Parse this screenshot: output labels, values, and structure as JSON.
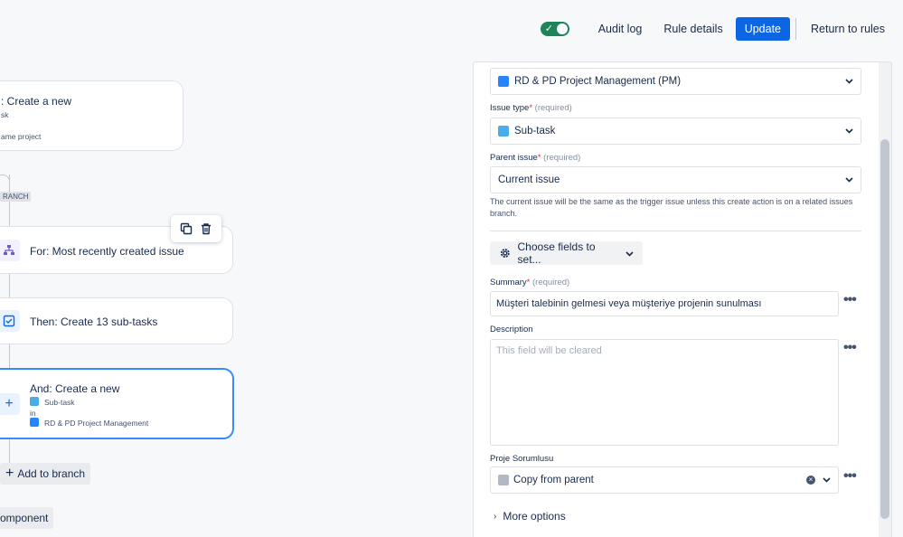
{
  "topbar": {
    "audit_log": "Audit log",
    "rule_details": "Rule details",
    "update": "Update",
    "return_to_rules": "Return to rules"
  },
  "canvas": {
    "card1": {
      "title": ": Create a new",
      "line2": "sk",
      "line3": "ame project"
    },
    "branch_tag": "RANCH",
    "card2": {
      "title": "For: Most recently created issue"
    },
    "card3": {
      "title": "Then: Create 13 sub-tasks"
    },
    "card4": {
      "title": "And: Create a new",
      "issue_type": "Sub-task",
      "in_label": "in",
      "project": "RD & PD Project Management"
    },
    "add_to_branch": "Add to branch",
    "add_component": "omponent"
  },
  "panel": {
    "project_value": "RD & PD Project Management (PM)",
    "issue_type_label": "Issue type",
    "issue_type_required": "(required)",
    "issue_type_value": "Sub-task",
    "parent_issue_label": "Parent issue",
    "parent_issue_required": "(required)",
    "parent_issue_value": "Current issue",
    "parent_help": "The current issue will be the same as the trigger issue unless this create action is on a related issues branch.",
    "choose_fields": "Choose fields to set...",
    "summary_label": "Summary",
    "summary_required": "(required)",
    "summary_value": "Müşteri talebinin gelmesi veya müşteriye projenin sunulması",
    "description_label": "Description",
    "description_placeholder": "This field will be cleared",
    "proje_label": "Proje Sorumlusu",
    "proje_value": "Copy from parent",
    "more_options": "More options"
  },
  "colors": {
    "accent": "#0c66e4",
    "toggle_on": "#1f845a",
    "selected_card_border": "#388bff"
  }
}
